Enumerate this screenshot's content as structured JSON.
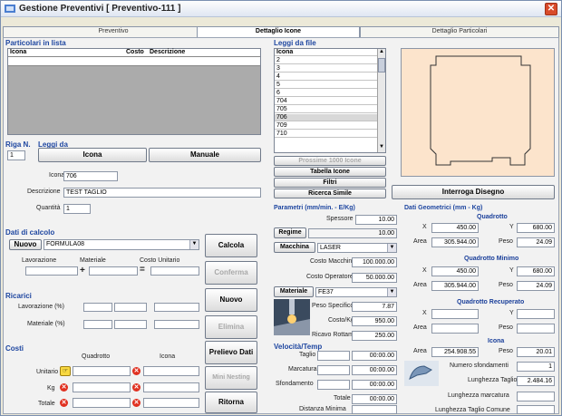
{
  "window": {
    "title": "Gestione Preventivi     [ Preventivo-111 ]"
  },
  "tabs": [
    "Preventivo",
    "Dettaglio Icone",
    "Dettaglio Particolari"
  ],
  "left": {
    "particolari_title": "Particolari in lista",
    "grid_headers": [
      "Icona",
      "Costo",
      "Descrizione"
    ],
    "riga_label": "Riga N.",
    "riga_value": "1",
    "leggi_da": "Leggi da",
    "btn_icona": "Icona",
    "btn_manuale": "Manuale",
    "icona_label": "Icona",
    "icona_value": "706",
    "descr_label": "Descrizione",
    "descr_value": "TEST TAGLIO",
    "quantita_label": "Quantità",
    "quantita_value": "1",
    "dati_calcolo": "Dati di calcolo",
    "btn_nuovo": "Nuovo",
    "formula": "FORMULA08",
    "lavorazione": "Lavorazione",
    "materiale": "Materiale",
    "costo_unitario": "Costo Unitario",
    "plus": "+",
    "equals": "=",
    "ricarici": "Ricarici",
    "ric_lav": "Lavorazione (%)",
    "ric_mat": "Materiale (%)",
    "costi": "Costi",
    "quadrotto": "Quadrotto",
    "icona_col": "Icona",
    "unitario": "Unitario",
    "kg": "Kg",
    "totale": "Totale"
  },
  "buttons": {
    "calcola": "Calcola",
    "conferma": "Conferma",
    "nuovo": "Nuovo",
    "elimina": "Elimina",
    "prelievo": "Prelievo Dati",
    "mini": "Mini Nesting",
    "ritorna": "Ritorna"
  },
  "middle": {
    "leggi_file": "Leggi da file",
    "list_header": "Icona",
    "list": [
      "2",
      "3",
      "4",
      "5",
      "6",
      "704",
      "705",
      "706",
      "709",
      "710"
    ],
    "selected": "706",
    "btn_prossime": "Prossime 1000 Icone",
    "btn_tabella": "Tabella Icone",
    "btn_filtri": "Filtri",
    "btn_ricerca": "Ricerca Simile",
    "param_title": "Parametri (mm/min. - E/Kg)",
    "spessore_label": "Spessore",
    "spessore": "10.00",
    "btn_regime": "Regime",
    "regime": "10.00",
    "btn_macchina": "Macchina",
    "macchina": "LASER",
    "costo_macchina_label": "Costo Macchina",
    "costo_macchina": "100.000.00",
    "costo_operatore_label": "Costo Operatore",
    "costo_operatore": "50.000.00",
    "btn_materiale": "Materiale",
    "materiale": "FE37",
    "peso_spec_label": "Peso Specifico",
    "peso_spec": "7.87",
    "costo_kg_label": "Costo/Kg",
    "costo_kg": "950.00",
    "ricavo_label": "Ricavo Rottame",
    "ricavo": "250.00",
    "velocita_title": "Velocità/Temp",
    "taglio_label": "Taglio",
    "taglio": "00:00.00",
    "marcatura_label": "Marcatura",
    "marcatura": "00:00.00",
    "sfondamento_label": "Sfondamento",
    "sfondamento": "00:00.00",
    "totale_label": "Totale",
    "totale": "00:00.00",
    "distanza_label": "Distanza Minima"
  },
  "right": {
    "btn_interroga": "Interroga Disegno",
    "dati_geo": "Dati Geometrici  (mm - Kg)",
    "quadrotto": "Quadrotto",
    "x_label": "X",
    "y_label": "Y",
    "area_label": "Area",
    "peso_label": "Peso",
    "q_x": "450.00",
    "q_y": "680.00",
    "q_area": "305.944.00",
    "q_peso": "24.09",
    "qmin": "Quadrotto Minimo",
    "qm_x": "450.00",
    "qm_y": "680.00",
    "qm_area": "305.944.00",
    "qm_peso": "24.09",
    "qrec": "Quadrotto Recuperato",
    "icona": "Icona",
    "i_area": "254.908.55",
    "i_peso": "20.01",
    "num_sfond_label": "Numero sfondamenti",
    "num_sfond": "1",
    "lung_taglio_label": "Lunghezza Taglio",
    "lung_taglio": "2.484.16",
    "lung_marc_label": "Lunghezza marcatura",
    "lung_comune_label": "Lunghezza Taglio Comune"
  }
}
